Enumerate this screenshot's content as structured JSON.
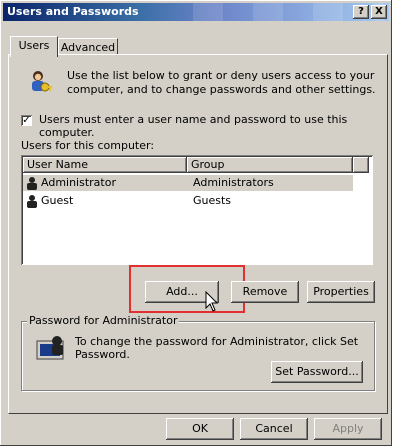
{
  "window": {
    "title": "Users and Passwords",
    "help_btn": "?",
    "close_btn": "X"
  },
  "tabs": [
    "Users",
    "Advanced"
  ],
  "intro": {
    "line1": "Use the list below to grant or deny users access to your",
    "line2": "computer, and to change passwords and other settings."
  },
  "checkbox": {
    "checked": true,
    "label": "Users must enter a user name and password to use this computer."
  },
  "users_label": "Users for this computer:",
  "table": {
    "headers": [
      "User Name",
      "Group"
    ],
    "rows": [
      {
        "name": "Administrator",
        "group": "Administrators"
      },
      {
        "name": "Guest",
        "group": "Guests"
      }
    ]
  },
  "buttons": {
    "add": "Add...",
    "remove": "Remove",
    "properties": "Properties"
  },
  "password_group": {
    "legend": "Password for Administrator",
    "line1": "To change the password for Administrator, click Set",
    "line2": "Password.",
    "set_password": "Set Password..."
  },
  "footer": {
    "ok": "OK",
    "cancel": "Cancel",
    "apply": "Apply"
  },
  "colors": {
    "highlight_box": "#e03030",
    "title_dark": "#0a246a",
    "face": "#d4d0c8"
  }
}
